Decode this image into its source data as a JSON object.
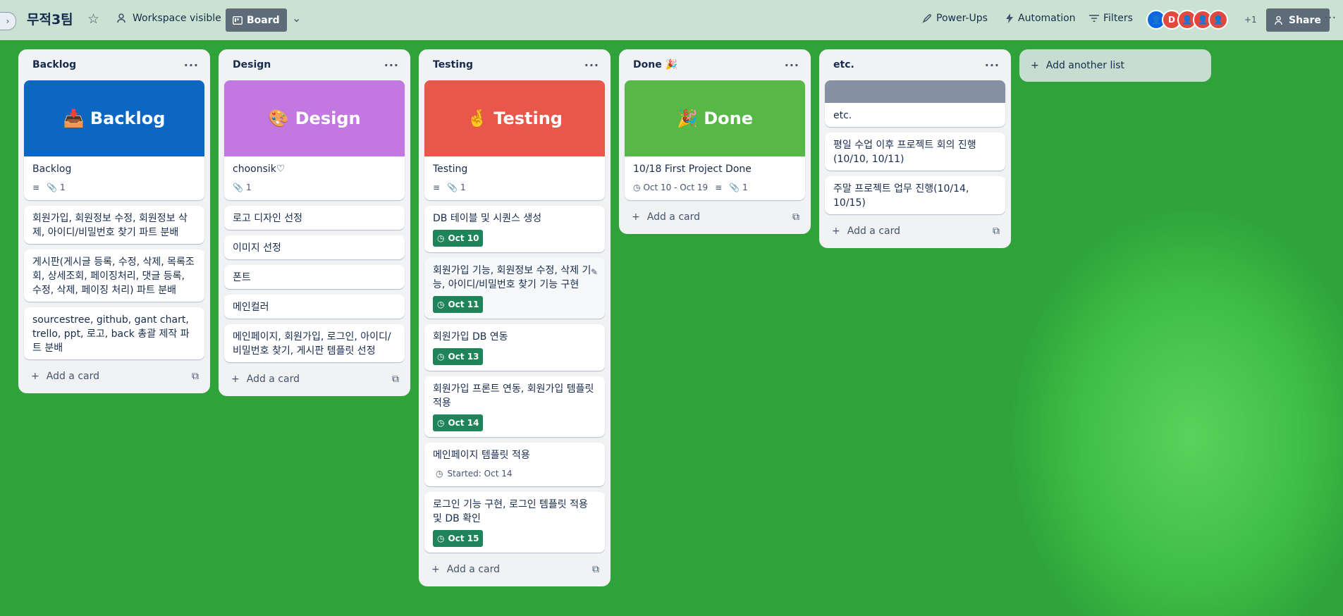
{
  "header": {
    "board_title": "무적3팀",
    "visibility": "Workspace visible",
    "view": "Board",
    "power_ups": "Power-Ups",
    "automation": "Automation",
    "filters": "Filters",
    "avatar_initial": "D",
    "extra_members": "+1",
    "share": "Share"
  },
  "add_card_label": "Add a card",
  "add_list_label": "Add another list",
  "lists": [
    {
      "title": "Backlog",
      "cover_text": "📥 Backlog",
      "cover_color": "#0c66c4",
      "cover_card_title": "Backlog",
      "cover_card_attachments": "1",
      "cards": [
        "회원가입, 회원정보 수정, 회원정보 삭제, 아이디/비밀번호 찾기 파트 분배",
        "게시판(게시글 등록, 수정, 삭제, 목록조회, 상세조회, 페이징처리, 댓글 등록, 수정, 삭제, 페이징 처리) 파트 분배",
        "sourcestree, github, gant chart, trello, ppt, 로고, back 총괄 제작 파트 분배"
      ]
    },
    {
      "title": "Design",
      "cover_text": "🎨 Design",
      "cover_color": "#c377e0",
      "cover_card_title": "choonsik♡",
      "cover_card_attachments": "1",
      "cards": [
        "로고 디자인 선정",
        "이미지 선정",
        "폰트",
        "메인컬러",
        "메인페이지, 회원가입, 로그인, 아이디/비밀번호 찾기, 게시판 템플릿 선정"
      ]
    },
    {
      "title": "Testing",
      "cover_text": "🤞 Testing",
      "cover_color": "#e8574a",
      "cover_card_title": "Testing",
      "cover_card_attachments": "1",
      "cards": [
        {
          "text": "DB 테이블 및 시퀀스 생성",
          "due": "Oct 10"
        },
        {
          "text": "회원가입 기능, 회원정보 수정, 삭제 기능, 아이디/비밀번호 찾기 기능 구현",
          "due": "Oct 11"
        },
        {
          "text": "회원가입 DB 연동",
          "due": "Oct 13"
        },
        {
          "text": "회원가입 프론트 연동, 회원가입 템플릿 적용",
          "due": "Oct 14"
        },
        {
          "text": "메인페이지 템플릿 적용",
          "started": "Started: Oct 14"
        },
        {
          "text": "로그인 기능 구현, 로그인 템플릿 적용 및 DB 확인",
          "due": "Oct 15"
        }
      ]
    },
    {
      "title": "Done 🎉",
      "cover_text": "🎉 Done",
      "cover_color": "#57b847",
      "cover_card_title": "10/18 First Project Done",
      "cover_card_dates": "Oct 10 - Oct 19",
      "cover_card_attachments": "1"
    },
    {
      "title": "etc.",
      "cover_color": "#8590a2",
      "cover_card_title": "etc.",
      "cards": [
        "평일 수업 이후 프로젝트 회의 진행(10/10, 10/11)",
        "주말 프로젝트 업무 진행(10/14, 10/15)"
      ]
    }
  ],
  "colors": {
    "due_green": "#1f845a",
    "list_bg": "#f1f2f4",
    "avatar_blue": "#0c66e4",
    "avatar_red": "#e2483d"
  }
}
